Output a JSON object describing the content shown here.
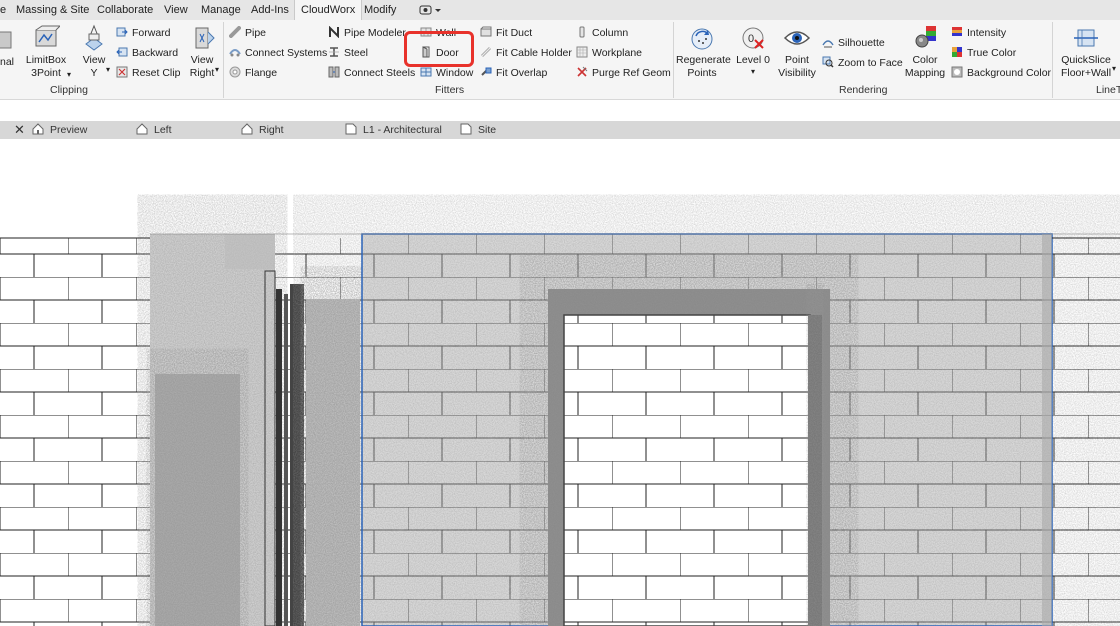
{
  "menu": {
    "tabs": [
      "e",
      "Massing & Site",
      "Collaborate",
      "View",
      "Manage",
      "Add-Ins",
      "CloudWorx",
      "Modify"
    ],
    "active": "CloudWorx"
  },
  "ribbon": {
    "clipping": {
      "label": "Clipping",
      "cut_left": "nal",
      "limitbox": "LimitBox\n3Point",
      "view_y": "View\nY",
      "forward": "Forward",
      "backward": "Backward",
      "reset_clip": "Reset Clip",
      "view_right": "View\nRight"
    },
    "fitters": {
      "label": "Fitters",
      "pipe": "Pipe",
      "connect_systems": "Connect Systems",
      "flange": "Flange",
      "pipe_modeler": "Pipe Modeler",
      "steel": "Steel",
      "connect_steels": "Connect Steels",
      "wall": "Wall",
      "door": "Door",
      "window": "Window",
      "fit_duct": "Fit Duct",
      "fit_cable_holder": "Fit Cable Holder",
      "fit_overlap": "Fit Overlap",
      "column": "Column",
      "workplane": "Workplane",
      "purge_ref_geom": "Purge Ref Geom"
    },
    "rendering": {
      "label": "Rendering",
      "regenerate_points": "Regenerate\nPoints",
      "level_0": "Level 0",
      "point_visibility": "Point\nVisibility",
      "silhouette": "Silhouette",
      "zoom_to_face": "Zoom to Face",
      "color_mapping": "Color\nMapping",
      "intensity": "Intensity",
      "true_color": "True Color",
      "background_color": "Background Color"
    },
    "linetools": {
      "label": "LineT",
      "quickslice": "QuickSlice\nFloor+Wall"
    }
  },
  "view_tabs": [
    "Preview",
    "Left",
    "Right",
    "L1 - Architectural",
    "Site"
  ],
  "colors": {
    "highlight": "#e8322b",
    "accent_blue": "#2a63b8"
  }
}
